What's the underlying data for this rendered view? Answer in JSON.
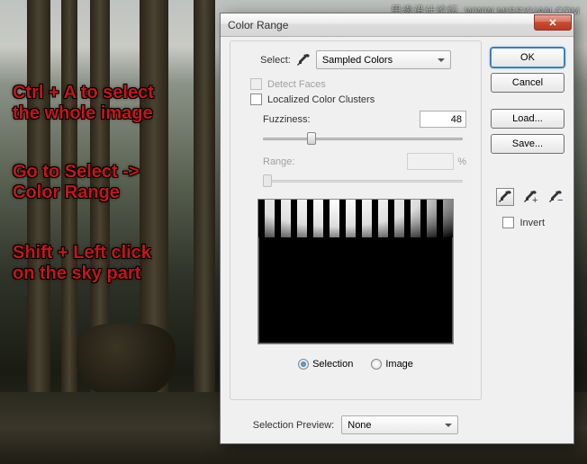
{
  "watermark": {
    "cn": "思缘设计论坛",
    "url": "WWW.MISSYUAN.COM"
  },
  "annotations": {
    "a1": "Ctrl + A to select\nthe whole image",
    "a2": "Go to Select ->\nColor Range",
    "a3": "Shift + Left click\non the sky part"
  },
  "dialog": {
    "title": "Color Range",
    "select_label": "Select:",
    "select_value": "Sampled Colors",
    "detect_faces": "Detect Faces",
    "localized": "Localized Color Clusters",
    "fuzziness_label": "Fuzziness:",
    "fuzziness_value": "48",
    "range_label": "Range:",
    "range_value": "",
    "range_unit": "%",
    "radio_selection": "Selection",
    "radio_image": "Image",
    "selprev_label": "Selection Preview:",
    "selprev_value": "None",
    "buttons": {
      "ok": "OK",
      "cancel": "Cancel",
      "load": "Load...",
      "save": "Save..."
    },
    "invert": "Invert"
  }
}
